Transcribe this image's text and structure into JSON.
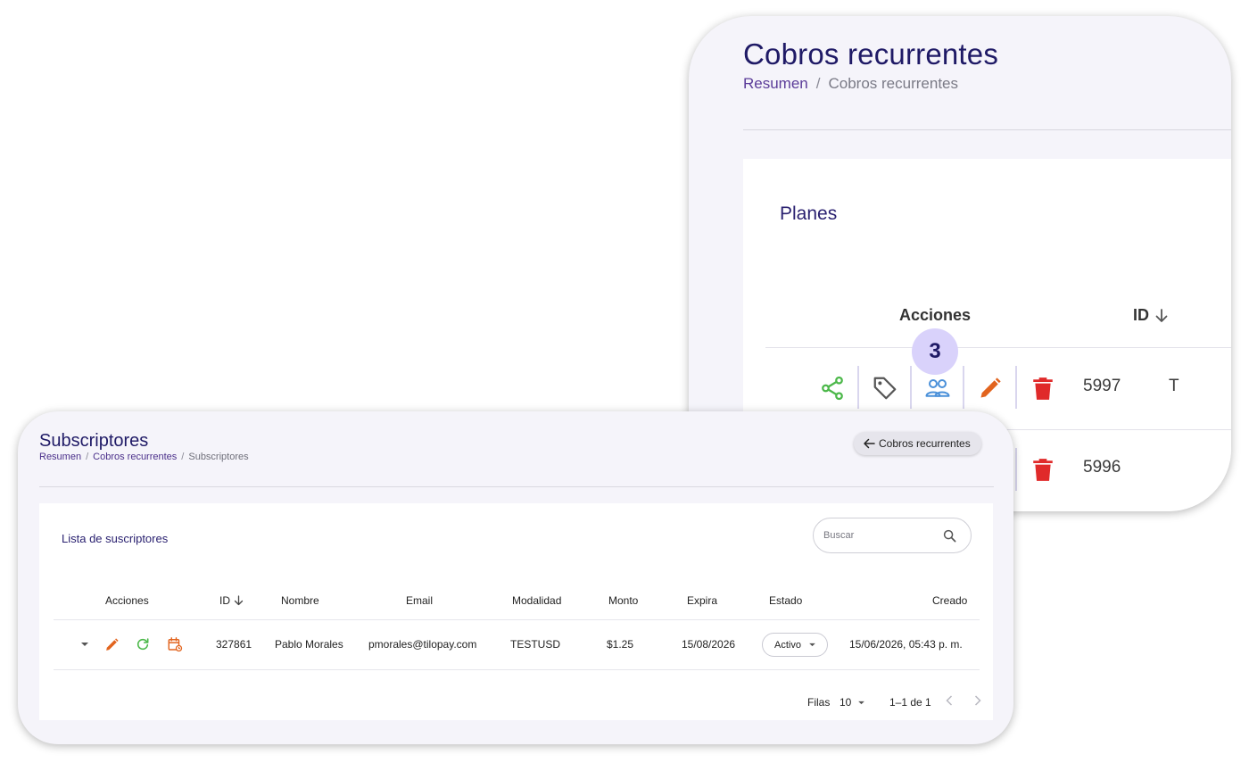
{
  "planes_view": {
    "page_title": "Cobros recurrentes",
    "breadcrumb": {
      "link": "Resumen",
      "separator": "/",
      "current": "Cobros recurrentes"
    },
    "panel_title": "Planes",
    "columns": {
      "actions": "Acciones",
      "id": "ID"
    },
    "step_badge": "3",
    "rows": [
      {
        "id": "5997",
        "next_col_fragment": "T"
      },
      {
        "id": "5996"
      }
    ],
    "icons": [
      "share-icon",
      "tag-icon",
      "subscribers-icon",
      "edit-icon",
      "delete-icon"
    ],
    "colors": {
      "share": "#4cb84a",
      "tag": "#555555",
      "subscribers": "#4a90d9",
      "edit": "#e2641e",
      "delete": "#e02a2a",
      "badge": "#d9d2fb"
    }
  },
  "subscribers_view": {
    "page_title": "Subscriptores",
    "breadcrumb": {
      "link1": "Resumen",
      "link2": "Cobros recurrentes",
      "separator": "/",
      "current": "Subscriptores"
    },
    "back_button_label": "Cobros recurrentes",
    "panel_title": "Lista de suscriptores",
    "search": {
      "placeholder": "Buscar"
    },
    "columns": {
      "actions": "Acciones",
      "id": "ID",
      "name": "Nombre",
      "email": "Email",
      "mode": "Modalidad",
      "amount": "Monto",
      "expires": "Expira",
      "status": "Estado",
      "created": "Creado"
    },
    "rows": [
      {
        "id": "327861",
        "name": "Pablo Morales",
        "email": "pmorales@tilopay.com",
        "mode": "TESTUSD",
        "amount": "$1.25",
        "expires": "15/08/2026",
        "status": "Activo",
        "created": "15/06/2026, 05:43 p. m."
      }
    ],
    "pagination": {
      "rows_label": "Filas",
      "rows_per_page": "10",
      "range": "1–1 de 1"
    },
    "icons": [
      "expand-icon",
      "edit-icon",
      "refresh-icon",
      "calendar-renew-icon",
      "search-icon",
      "arrow-left-icon"
    ],
    "colors": {
      "title": "#1f1a66",
      "edit": "#e2641e",
      "refresh": "#4cb84a",
      "calendar": "#e2641e"
    }
  }
}
